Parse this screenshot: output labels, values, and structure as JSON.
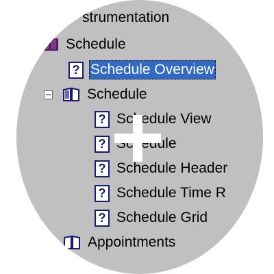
{
  "tree": {
    "top_partial_label": "strumentation",
    "items": [
      {
        "label": "Schedule",
        "icon": "book-icon",
        "type": "book"
      },
      {
        "label": "Schedule Overview",
        "icon": "help-page-icon",
        "type": "page",
        "selected": true
      },
      {
        "label": "Schedule",
        "icon": "book-open-icon",
        "type": "book",
        "expanded": true
      },
      {
        "label": "Schedule View",
        "icon": "help-page-icon",
        "type": "page"
      },
      {
        "label": "Schedule",
        "icon": "help-page-icon",
        "type": "page"
      },
      {
        "label": "Schedule Header",
        "icon": "help-page-icon",
        "type": "page"
      },
      {
        "label": "Schedule Time R",
        "icon": "help-page-icon",
        "type": "page"
      },
      {
        "label": "Schedule Grid",
        "icon": "help-page-icon",
        "type": "page"
      },
      {
        "label": "Appointments",
        "icon": "book-icon",
        "type": "book"
      }
    ],
    "help_glyph": "?"
  },
  "colors": {
    "magnifier_bg": "#c0c0c0",
    "selection_bg": "#3169c6",
    "icon_ink": "#1a1a7a",
    "book_purple": "#5a1a6a"
  },
  "cursor": {
    "icon": "crosshair-cursor-icon"
  }
}
